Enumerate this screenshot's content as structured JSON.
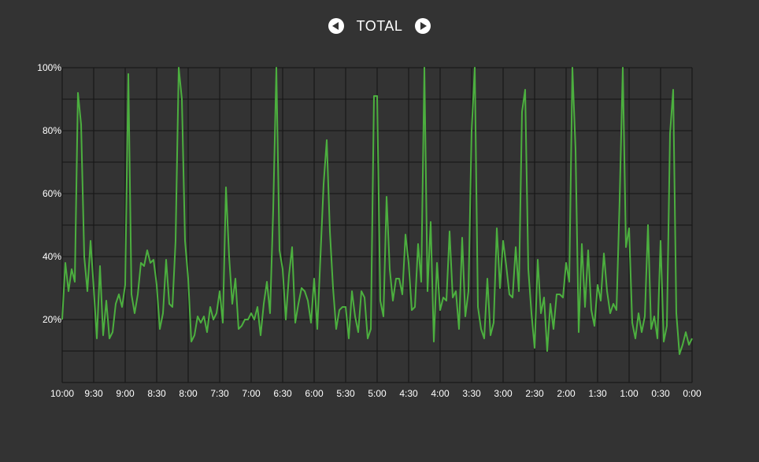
{
  "header": {
    "title": "TOTAL"
  },
  "colors": {
    "line": "#4caf3f",
    "grid": "#1a1a1a",
    "background": "#333333",
    "text": "#ffffff"
  },
  "icons": {
    "prev": "arrow-left-circle-icon",
    "next": "arrow-right-circle-icon"
  },
  "chart_data": {
    "type": "line",
    "title": "TOTAL",
    "xlabel": "",
    "ylabel": "",
    "ylim": [
      0,
      100
    ],
    "grid": true,
    "y_ticks": [
      {
        "value": 100,
        "label": "100%"
      },
      {
        "value": 80,
        "label": "80%"
      },
      {
        "value": 60,
        "label": "60%"
      },
      {
        "value": 40,
        "label": "40%"
      },
      {
        "value": 20,
        "label": "20%"
      }
    ],
    "x_tick_labels": [
      "10:00",
      "9:30",
      "9:00",
      "8:30",
      "8:00",
      "7:30",
      "7:00",
      "6:30",
      "6:00",
      "5:30",
      "5:00",
      "4:30",
      "4:00",
      "3:30",
      "3:00",
      "2:30",
      "2:00",
      "1:30",
      "1:00",
      "0:30",
      "0:00"
    ],
    "x_domain": [
      0,
      600
    ],
    "series": [
      {
        "x": [
          0,
          3,
          6,
          9,
          12,
          15,
          18,
          21,
          24,
          27,
          30,
          33,
          36,
          39,
          42,
          45,
          48,
          51,
          54,
          57,
          60,
          63,
          66,
          69,
          72,
          75,
          78,
          81,
          84,
          87,
          90,
          93,
          96,
          99,
          102,
          105,
          108,
          111,
          114,
          117,
          120,
          123,
          126,
          129,
          132,
          135,
          138,
          141,
          144,
          147,
          150,
          153,
          156,
          159,
          162,
          165,
          168,
          171,
          174,
          177,
          180,
          183,
          186,
          189,
          192,
          195,
          198,
          201,
          204,
          207,
          210,
          213,
          216,
          219,
          222,
          225,
          228,
          231,
          234,
          237,
          240,
          243,
          246,
          249,
          252,
          255,
          258,
          261,
          264,
          267,
          270,
          273,
          276,
          279,
          282,
          285,
          288,
          291,
          294,
          297,
          300,
          303,
          306,
          309,
          312,
          315,
          318,
          321,
          324,
          327,
          330,
          333,
          336,
          339,
          342,
          345,
          348,
          351,
          354,
          357,
          360,
          363,
          366,
          369,
          372,
          375,
          378,
          381,
          384,
          387,
          390,
          393,
          396,
          399,
          402,
          405,
          408,
          411,
          414,
          417,
          420,
          423,
          426,
          429,
          432,
          435,
          438,
          441,
          444,
          447,
          450,
          453,
          456,
          459,
          462,
          465,
          468,
          471,
          474,
          477,
          480,
          483,
          486,
          489,
          492,
          495,
          498,
          501,
          504,
          507,
          510,
          513,
          516,
          519,
          522,
          525,
          528,
          531,
          534,
          537,
          540,
          543,
          546,
          549,
          552,
          555,
          558,
          561,
          564,
          567,
          570,
          573,
          576,
          579,
          582,
          585,
          588,
          591,
          594,
          597,
          600
        ],
        "y": [
          20,
          38,
          29,
          36,
          32,
          92,
          82,
          40,
          29,
          45,
          30,
          14,
          37,
          15,
          26,
          14,
          16,
          25,
          28,
          24,
          31,
          98,
          28,
          22,
          28,
          38,
          37,
          42,
          38,
          39,
          31,
          17,
          22,
          39,
          25,
          24,
          45,
          100,
          90,
          45,
          33,
          13,
          15,
          21,
          19,
          21,
          16,
          24,
          20,
          22,
          29,
          19,
          62,
          40,
          25,
          33,
          17,
          18,
          20,
          20,
          22,
          20,
          24,
          15,
          25,
          32,
          22,
          55,
          100,
          42,
          36,
          20,
          34,
          43,
          19,
          25,
          30,
          29,
          26,
          19,
          33,
          17,
          40,
          63,
          77,
          48,
          30,
          17,
          23,
          24,
          24,
          14,
          29,
          21,
          16,
          29,
          27,
          14,
          17,
          91,
          91,
          26,
          21,
          59,
          36,
          26,
          33,
          33,
          28,
          47,
          38,
          23,
          24,
          44,
          32,
          100,
          29,
          51,
          13,
          38,
          23,
          27,
          26,
          48,
          27,
          29,
          17,
          46,
          21,
          29,
          80,
          100,
          24,
          17,
          14,
          33,
          15,
          19,
          49,
          30,
          45,
          37,
          28,
          27,
          43,
          29,
          86,
          93,
          36,
          22,
          11,
          39,
          22,
          27,
          10,
          25,
          17,
          28,
          28,
          27,
          38,
          32,
          100,
          74,
          16,
          44,
          24,
          42,
          23,
          18,
          31,
          26,
          41,
          29,
          22,
          25,
          23,
          58,
          100,
          43,
          49,
          19,
          14,
          22,
          16,
          21,
          50,
          17,
          21,
          14,
          45,
          13,
          18,
          79,
          93,
          22,
          9,
          12,
          16,
          12,
          14
        ]
      }
    ]
  }
}
